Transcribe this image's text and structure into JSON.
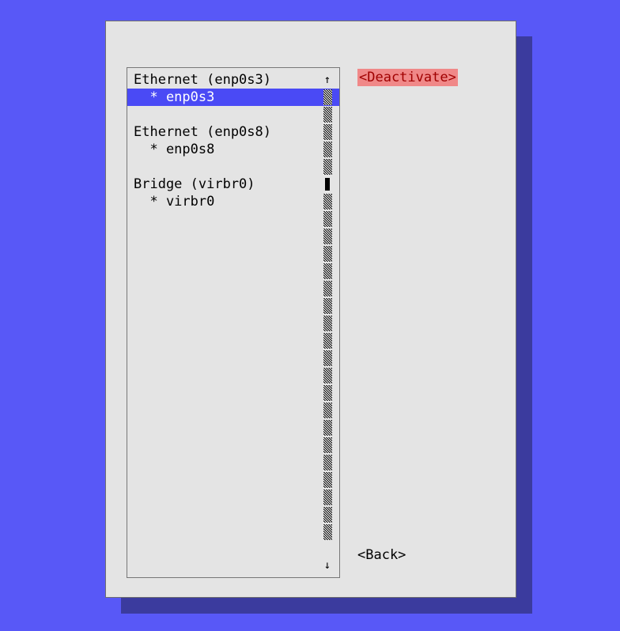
{
  "list": {
    "groups": [
      {
        "header": "Ethernet (enp0s3)",
        "items": [
          "* enp0s3"
        ],
        "selectedItem": 0
      },
      {
        "header": "Ethernet (enp0s8)",
        "items": [
          "* enp0s8"
        ]
      },
      {
        "header": "Bridge (virbr0)",
        "items": [
          "* virbr0"
        ]
      }
    ],
    "selectedGroup": 0
  },
  "scrollbar": {
    "upArrow": "↑",
    "downArrow": "↓",
    "thumbPosition": 5,
    "segments": 26
  },
  "buttons": {
    "deactivate": "<Deactivate>",
    "back": "<Back>"
  }
}
